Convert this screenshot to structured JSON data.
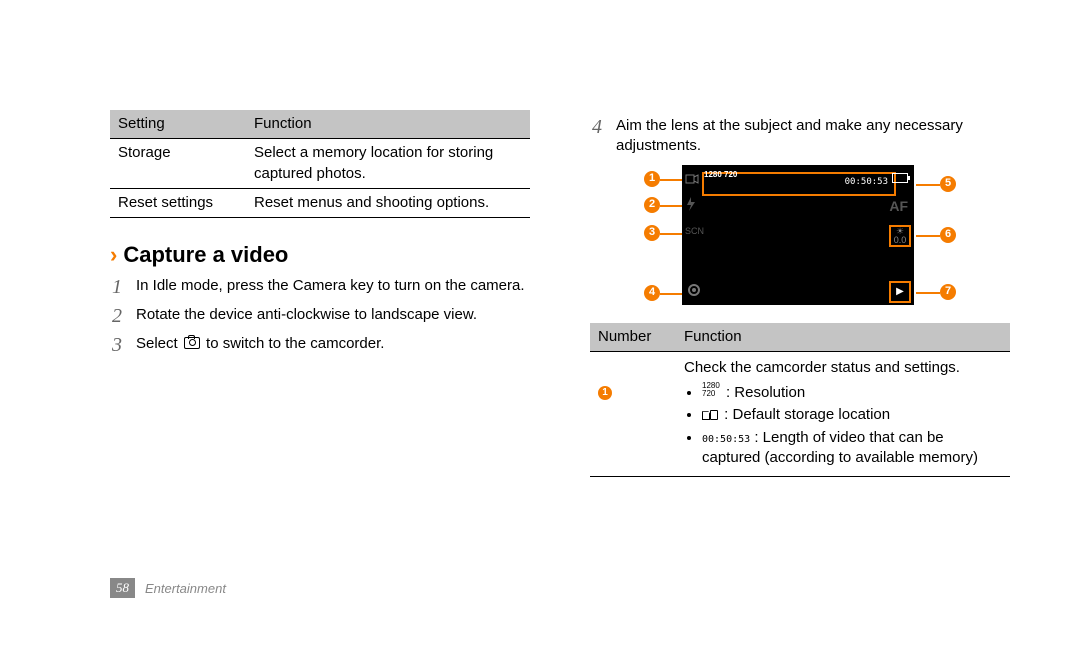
{
  "settings_table": {
    "headers": [
      "Setting",
      "Function"
    ],
    "rows": [
      {
        "setting": "Storage",
        "function": "Select a memory location for storing captured photos."
      },
      {
        "setting": "Reset settings",
        "function": "Reset menus and shooting options."
      }
    ]
  },
  "heading": "Capture a video",
  "steps_left": [
    {
      "n": "1",
      "text": "In Idle mode, press the Camera key to turn on the camera."
    },
    {
      "n": "2",
      "text": "Rotate the device anti-clockwise to landscape view."
    },
    {
      "n": "3",
      "pre": "Select ",
      "post": " to switch to the camcorder."
    }
  ],
  "step4": {
    "n": "4",
    "text": "Aim the lens at the subject and make any necessary adjustments."
  },
  "diagram": {
    "resolution_label": "1280\n720",
    "time_label": "00:50:53",
    "af_label": "AF",
    "expo_label": "0.0",
    "callouts": [
      "1",
      "2",
      "3",
      "4",
      "5",
      "6",
      "7"
    ]
  },
  "nf_table": {
    "headers": [
      "Number",
      "Function"
    ],
    "row1": {
      "badge": "1",
      "intro": "Check the camcorder status and settings.",
      "bullets": {
        "res": " : Resolution",
        "storage": " : Default storage location",
        "time_code": "00:50:53",
        "time_rest": " : Length of video that can be captured (according to available memory)"
      }
    }
  },
  "footer": {
    "page": "58",
    "section": "Entertainment"
  }
}
